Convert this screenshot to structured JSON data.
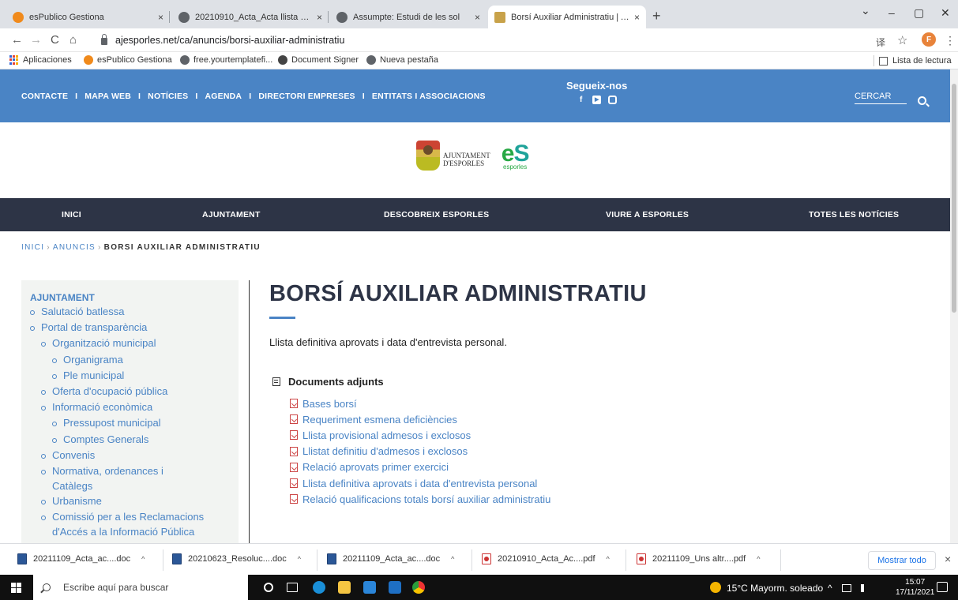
{
  "tabs": [
    {
      "title": "esPublico Gestiona",
      "active": false
    },
    {
      "title": "20210910_Acta_Acta llista definiti",
      "active": false
    },
    {
      "title": "Assumpte: Estudi de les sol",
      "active": false
    },
    {
      "title": "Borsí Auxiliar Administratiu | Ajun",
      "active": true
    }
  ],
  "tab_close_glyph": "×",
  "new_tab_glyph": "+",
  "address": {
    "url": "ajesporles.net/ca/anuncis/borsi-auxiliar-administratiu"
  },
  "profile_initial": "F",
  "bookmarks": {
    "apps": "Aplicaciones",
    "items": [
      "esPublico Gestiona",
      "free.yourtemplatefi...",
      "Document Signer",
      "Nueva pestaña"
    ],
    "reading_list": "Lista de lectura"
  },
  "topbar": {
    "links": [
      "CONTACTE",
      "MAPA WEB",
      "NOTÍCIES",
      "AGENDA",
      "DIRECTORI EMPRESES",
      "ENTITATS I ASSOCIACIONS"
    ],
    "separator": "I",
    "follow_title": "Segueix-nos",
    "search_label": "CERCAR"
  },
  "logo": {
    "line1": "AJUNTAMENT",
    "line2": "D'ESPORLES",
    "es_small": "esporles"
  },
  "mainnav": [
    "INICI",
    "AJUNTAMENT",
    "DESCOBREIX ESPORLES",
    "VIURE A ESPORLES",
    "TOTES LES NOTÍCIES"
  ],
  "breadcrumb": {
    "items": [
      "INICI",
      "ANUNCIS"
    ],
    "current": "BORSI AUXILIAR ADMINISTRATIU",
    "sep": "›"
  },
  "sidebar": {
    "title": "AJUNTAMENT",
    "items": [
      {
        "label": "Salutació batlessa",
        "level": 1
      },
      {
        "label": "Portal de transparència",
        "level": 1
      },
      {
        "label": "Organització municipal",
        "level": 2
      },
      {
        "label": "Organigrama",
        "level": 3
      },
      {
        "label": "Ple municipal",
        "level": 3
      },
      {
        "label": "Oferta d'ocupació pública",
        "level": 2
      },
      {
        "label": "Informació econòmica",
        "level": 2
      },
      {
        "label": "Pressupost municipal",
        "level": 3
      },
      {
        "label": "Comptes Generals",
        "level": 3
      },
      {
        "label": "Convenis",
        "level": 2
      },
      {
        "label": "Normativa, ordenances i Catàlegs",
        "level": 2
      },
      {
        "label": "Urbanisme",
        "level": 2
      },
      {
        "label": "Comissió per a les Reclamacions d'Accés a la Informació Pública",
        "level": 2
      }
    ]
  },
  "main": {
    "title": "BORSÍ AUXILIAR ADMINISTRATIU",
    "intro": "Llista definitiva aprovats i data d'entrevista personal.",
    "docs_heading": "Documents adjunts",
    "docs": [
      "Bases borsí",
      "Requeriment esmena deficiències",
      "Llista provisional admesos i exclosos",
      "Llistat definitiu d'admesos i exclosos",
      "Relació aprovats primer exercici",
      "Llista definitiva aprovats i data d'entrevista personal",
      "Relació qualificacions totals borsí auxiliar administratiu"
    ]
  },
  "downloads": {
    "items": [
      {
        "name": "20211109_Acta_ac....doc",
        "type": "word"
      },
      {
        "name": "20210623_Resoluc....doc",
        "type": "word"
      },
      {
        "name": "20211109_Acta_ac....doc",
        "type": "word"
      },
      {
        "name": "20210910_Acta_Ac....pdf",
        "type": "pdf"
      },
      {
        "name": "20211109_Uns altr....pdf",
        "type": "pdf"
      }
    ],
    "show_all": "Mostrar todo",
    "chevron": "^",
    "close": "×"
  },
  "taskbar": {
    "search_placeholder": "Escribe aquí para buscar",
    "weather": "15°C  Mayorm. soleado",
    "time": "15:07",
    "date": "17/11/2021"
  },
  "colors": {
    "topbar": "#4a84c5",
    "mainnav": "#2d3446",
    "link": "#4a84c5",
    "title": "#2d3446"
  },
  "icons": {
    "back": "←",
    "forward": "→",
    "reload": "C",
    "home": "⌂",
    "translate": "译",
    "star": "☆",
    "menu": "⋮",
    "minimize": "–",
    "maximize": "▢",
    "close": "✕",
    "tab_list": "⌄",
    "facebook": "f",
    "youtube": "▶"
  }
}
